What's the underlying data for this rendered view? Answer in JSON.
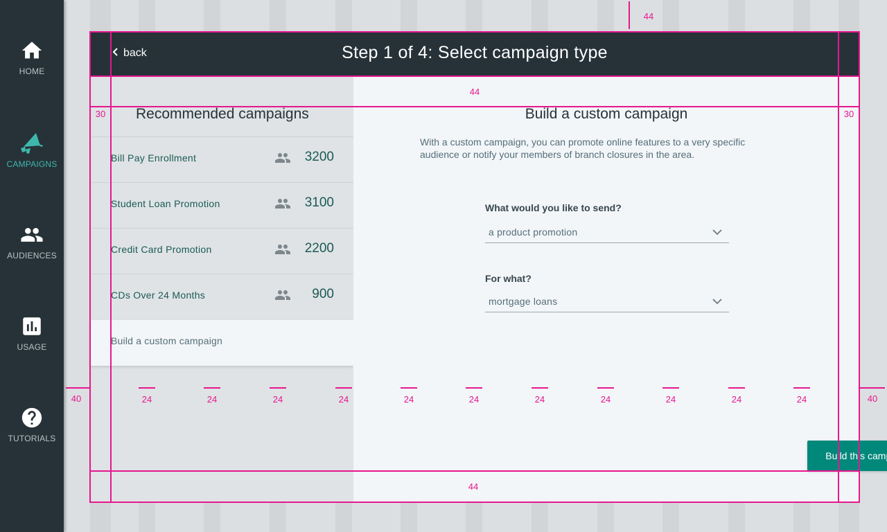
{
  "sidebar": {
    "items": [
      {
        "label": "HOME",
        "icon": "home-icon",
        "active": false
      },
      {
        "label": "CAMPAIGNS",
        "icon": "megaphone-icon",
        "active": true
      },
      {
        "label": "AUDIENCES",
        "icon": "people-icon",
        "active": false
      },
      {
        "label": "USAGE",
        "icon": "bar-chart-icon",
        "active": false
      },
      {
        "label": "TUTORIALS",
        "icon": "help-icon",
        "active": false
      }
    ]
  },
  "header": {
    "back_label": "back",
    "title": "Step 1 of 4: Select campaign type"
  },
  "recommended": {
    "title": "Recommended campaigns",
    "campaigns": [
      {
        "name": "Bill Pay Enrollment",
        "count": "3200"
      },
      {
        "name": "Student Loan Promotion",
        "count": "3100"
      },
      {
        "name": "Credit Card Promotion",
        "count": "2200"
      },
      {
        "name": "CDs Over 24 Months",
        "count": "900"
      }
    ],
    "custom_label": "Build a custom campaign"
  },
  "custom": {
    "title": "Build a custom campaign",
    "description": "With a custom campaign, you can promote online features to a very specific audience or notify your members of branch closures in the area.",
    "send_label": "What would you like to send?",
    "send_value": "a product promotion",
    "for_label": "For what?",
    "for_value": "mortgage loans",
    "button_label": "Build this campaign"
  },
  "spec": {
    "top_margin": "44",
    "header_gap": "44",
    "bottom_margin": "44",
    "side_padding_left": "30",
    "side_padding_right": "30",
    "outer_left": "40",
    "outer_right": "40",
    "gutter": "24"
  },
  "colors": {
    "sidebar_bg": "#263238",
    "accent": "#00897b",
    "active_nav": "#3fb6ac",
    "spec_overlay": "#e6168f"
  }
}
